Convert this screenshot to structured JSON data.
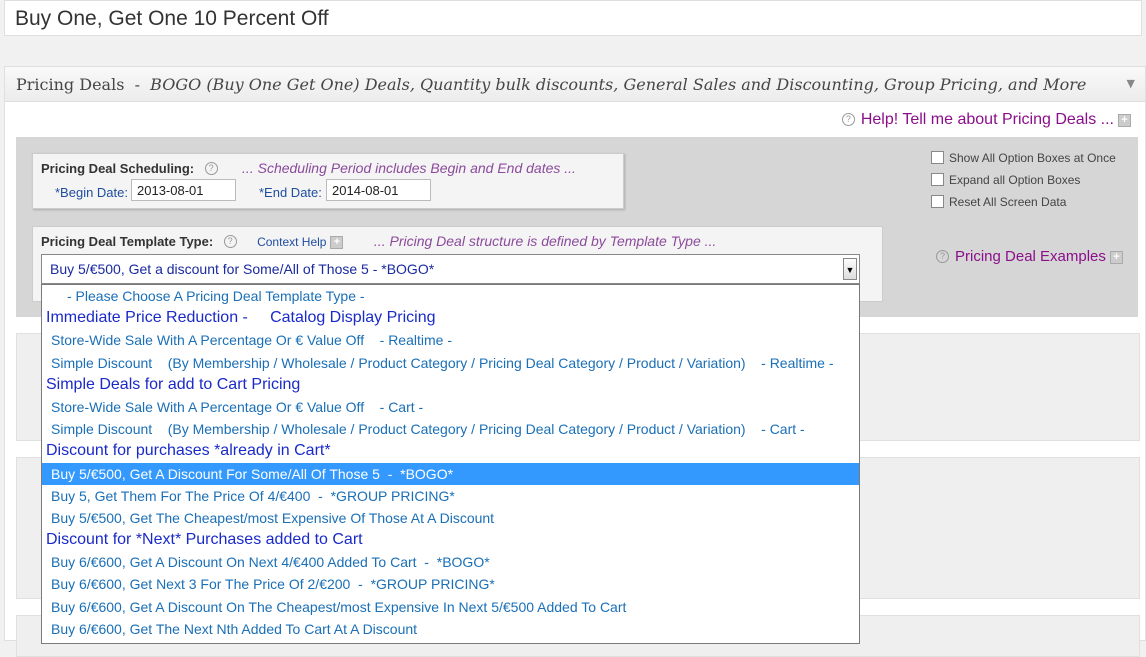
{
  "page": {
    "title": "Buy One, Get One 10 Percent Off"
  },
  "metabox": {
    "title_main": "Pricing Deals",
    "title_sep": "-",
    "title_rest": "BOGO (Buy One Get One) Deals,  Quantity bulk discounts,  General Sales  and  Discounting,  Group Pricing,  and  More",
    "help_link": "Help! Tell me about Pricing Deals ..."
  },
  "scheduling": {
    "label": "Pricing Deal Scheduling:",
    "note": "... Scheduling Period includes Begin and End dates ...",
    "begin_label": "*Begin Date:",
    "begin_value": "2013-08-01",
    "end_label": "*End Date:",
    "end_value": "2014-08-01"
  },
  "template": {
    "label": "Pricing Deal Template Type:",
    "context_help": "Context Help",
    "note": "... Pricing Deal structure is defined by Template Type ...",
    "selected": "Buy 5/€500, Get a discount for Some/All of Those 5  -  *BOGO*"
  },
  "options": {
    "show_all": "Show All Option Boxes at Once",
    "expand_all": "Expand all Option Boxes",
    "reset": "Reset All Screen Data",
    "examples": "Pricing Deal Examples"
  },
  "dropdown": {
    "items": [
      {
        "type": "first",
        "text": "- Please Choose A Pricing Deal Template Type -"
      },
      {
        "type": "head",
        "text": "Immediate Price Reduction -     Catalog Display Pricing"
      },
      {
        "type": "item",
        "text": "Store-Wide Sale With A Percentage Or € Value Off    - Realtime -"
      },
      {
        "type": "item",
        "text": "Simple Discount    (By Membership / Wholesale / Product Category / Pricing Deal Category / Product / Variation)    - Realtime -"
      },
      {
        "type": "head",
        "text": "Simple Deals for add to Cart Pricing"
      },
      {
        "type": "item",
        "text": "Store-Wide Sale With A Percentage Or € Value Off    - Cart -"
      },
      {
        "type": "item",
        "text": "Simple Discount    (By Membership / Wholesale / Product Category / Pricing Deal Category / Product / Variation)    - Cart -"
      },
      {
        "type": "head",
        "text": "Discount for purchases *already in Cart*"
      },
      {
        "type": "selected",
        "text": "Buy 5/€500, Get A Discount For Some/All Of Those 5  -  *BOGO*"
      },
      {
        "type": "item",
        "text": "Buy 5, Get Them For The Price Of 4/€400  -  *GROUP PRICING*"
      },
      {
        "type": "item",
        "text": "Buy 5/€500, Get The Cheapest/most Expensive Of Those At A Discount"
      },
      {
        "type": "head",
        "text": "Discount for *Next* Purchases added to Cart"
      },
      {
        "type": "item",
        "text": "Buy 6/€600, Get A Discount On Next 4/€400 Added To Cart  -  *BOGO*"
      },
      {
        "type": "item",
        "text": "Buy 6/€600, Get Next 3 For The Price Of 2/€200  -  *GROUP PRICING*"
      },
      {
        "type": "item",
        "text": "Buy 6/€600, Get A Discount On The Cheapest/most Expensive In Next 5/€500 Added To Cart"
      },
      {
        "type": "item",
        "text": "Buy 6/€600, Get The Next Nth Added To Cart At A Discount"
      }
    ]
  }
}
